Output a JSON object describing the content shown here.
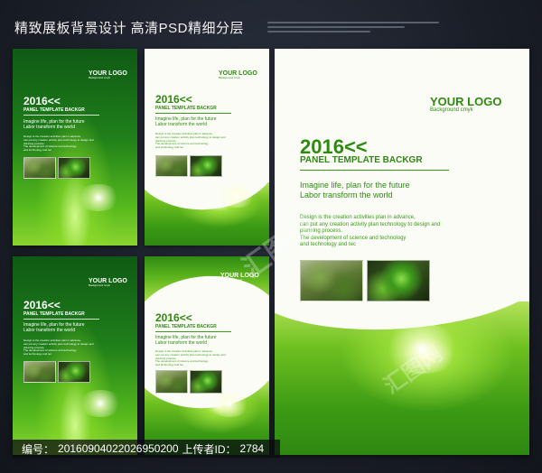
{
  "header": {
    "title": "精致展板背景设计 高清PSD精细分层"
  },
  "panel": {
    "logo": "YOUR LOGO",
    "logo_sub": "Background cmyk",
    "year": "2016<<",
    "title": "PANEL TEMPLATE BACKGR",
    "slogan_1": "Imagine life, plan for the future",
    "slogan_2": "Labor transform the world",
    "body": [
      "Design is the creation activities plan in advance,",
      "can put any creation activity plan technology to design and",
      "planning process.",
      "The development of science and technology",
      "and technology and tec"
    ]
  },
  "watermark": {
    "text": "汇图网"
  },
  "footer": {
    "id_label": "编号：",
    "id_value": "20160904022026950200",
    "uploader_label": "上传者ID：",
    "uploader_value": "2784"
  },
  "colors": {
    "brand_green": "#2f8a12",
    "dark_green": "#0f5a14",
    "background": "#1a1e27"
  }
}
